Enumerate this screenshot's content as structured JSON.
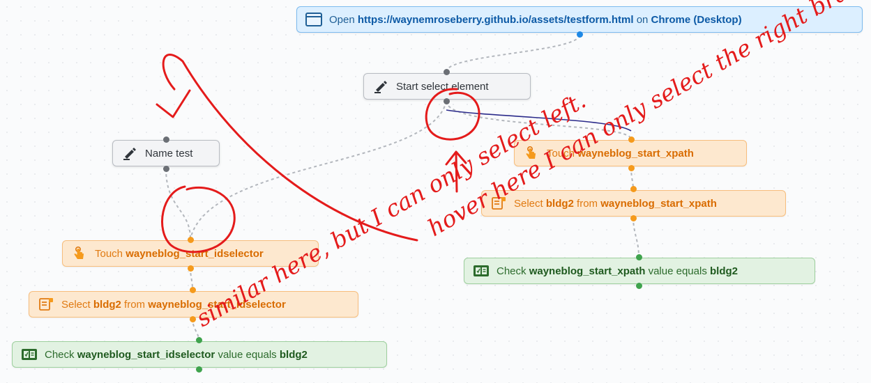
{
  "colors": {
    "accent_blue": "#1e88e5",
    "action_orange": "#f59a1c",
    "check_green": "#3fa34d",
    "annotation_red": "#e41b1b",
    "wire_purple": "#2a2a8a"
  },
  "nodes": {
    "open_url": {
      "icon": "browser-window-icon",
      "prefix": "Open",
      "url": "https://waynemroseberry.github.io/assets/testform.html",
      "mid": "on",
      "browser": "Chrome (Desktop)"
    },
    "start_select": {
      "icon": "pen-icon",
      "label": "Start select element"
    },
    "name_test": {
      "icon": "pen-icon",
      "label": "Name test"
    },
    "touch_right": {
      "icon": "touch-hand-icon",
      "prefix": "Touch",
      "target": "wayneblog_start_xpath"
    },
    "select_right": {
      "icon": "dropdown-select-icon",
      "prefix": "Select",
      "value": "bldg2",
      "mid": "from",
      "target": "wayneblog_start_xpath"
    },
    "check_right": {
      "icon": "check-value-icon",
      "prefix": "Check",
      "target": "wayneblog_start_xpath",
      "mid": "value equals",
      "value": "bldg2"
    },
    "touch_left": {
      "icon": "touch-hand-icon",
      "prefix": "Touch",
      "target": "wayneblog_start_idselector"
    },
    "select_left": {
      "icon": "dropdown-select-icon",
      "prefix": "Select",
      "value": "bldg2",
      "mid": "from",
      "target": "wayneblog_start_idselector"
    },
    "check_left": {
      "icon": "check-value-icon",
      "prefix": "Check",
      "target": "wayneblog_start_idselector",
      "mid": "value equals",
      "value": "bldg2"
    }
  },
  "annotations": {
    "right_note": "hover here I can only select the right branch",
    "left_note": "similar here, but I can only select left."
  }
}
